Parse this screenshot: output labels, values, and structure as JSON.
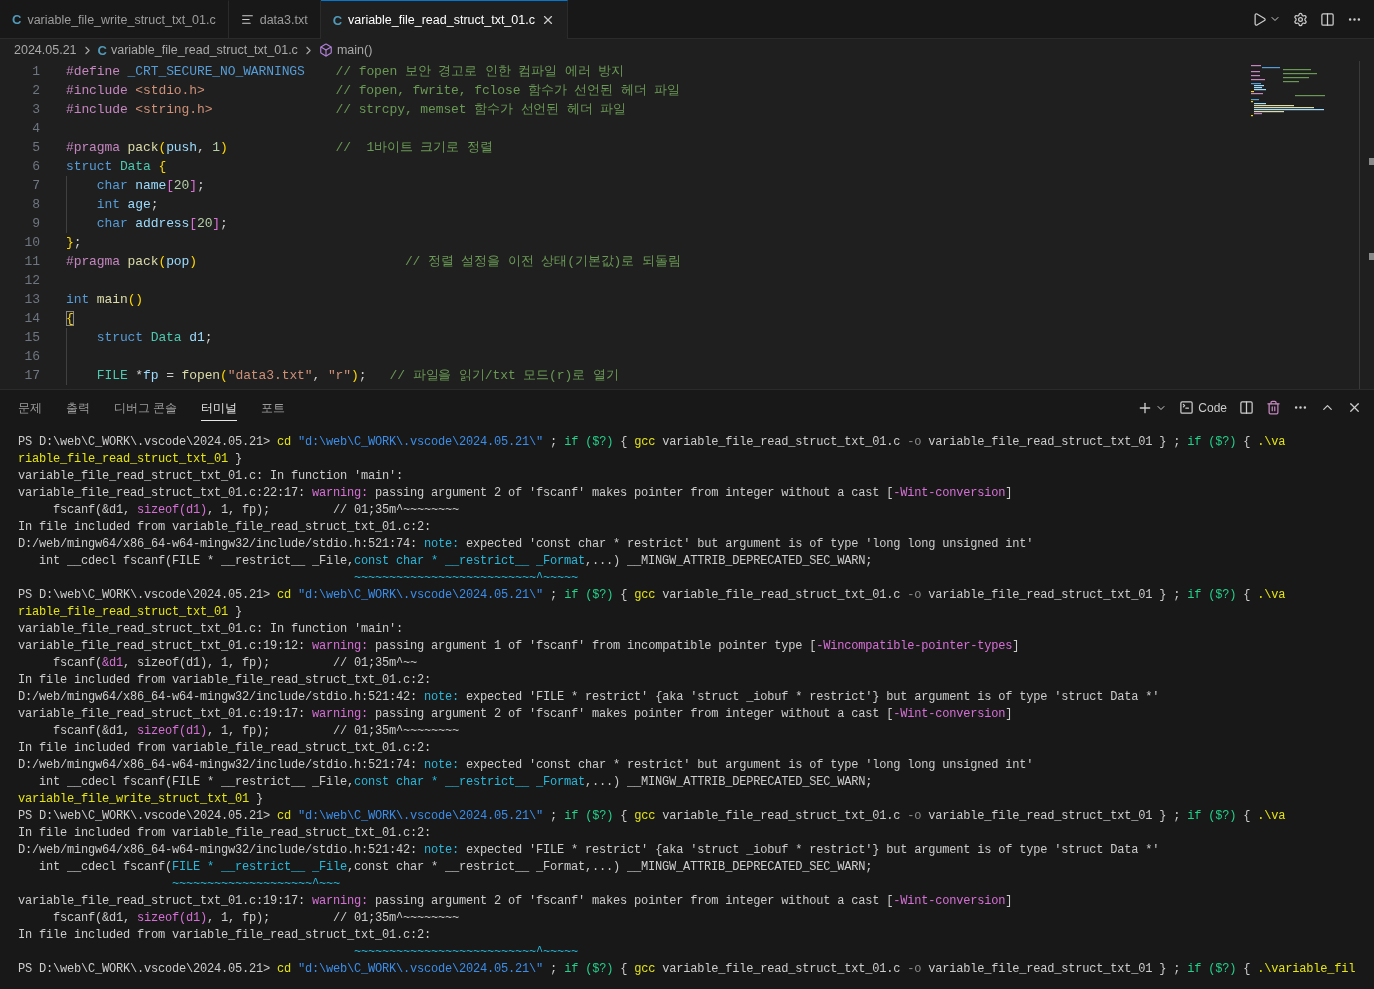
{
  "editor_tabs": [
    {
      "label": "variable_file_write_struct_txt_01.c",
      "kind": "c",
      "badge": "C",
      "selected": false
    },
    {
      "label": "data3.txt",
      "kind": "text",
      "selected": false
    },
    {
      "label": "variable_file_read_struct_txt_01.c",
      "kind": "c",
      "badge": "C",
      "selected": true
    }
  ],
  "breadcrumb": [
    {
      "label": "2024.05.21",
      "kind": "folder"
    },
    {
      "label": "variable_file_read_struct_txt_01.c",
      "kind": "c",
      "badge": "C"
    },
    {
      "label": "main()",
      "kind": "symbol"
    }
  ],
  "code_lines": [
    {
      "number": "1",
      "tokens": [
        {
          "text": "#define",
          "kind": "pp"
        },
        {
          "text": " _CRT_SECURE_NO_WARNINGS",
          "kind": "macro"
        },
        {
          "text": "    // fopen 보안 경고로 인한 컴파일 에러 방지",
          "kind": "cm"
        }
      ]
    },
    {
      "number": "2",
      "tokens": [
        {
          "text": "#include",
          "kind": "pp"
        },
        {
          "text": " <stdio.h>",
          "kind": "str"
        },
        {
          "text": "                 // fopen, fwrite, fclose 함수가 선언된 헤더 파일",
          "kind": "cm"
        }
      ]
    },
    {
      "number": "3",
      "tokens": [
        {
          "text": "#include",
          "kind": "pp"
        },
        {
          "text": " <string.h>",
          "kind": "str"
        },
        {
          "text": "                // strcpy, memset 함수가 선언된 헤더 파일",
          "kind": "cm"
        }
      ]
    },
    {
      "number": "4"
    },
    {
      "number": "5",
      "tokens": [
        {
          "text": "#pragma",
          "kind": "pp"
        },
        {
          "text": " pack",
          "kind": "fn"
        },
        {
          "text": "(",
          "kind": "paren"
        },
        {
          "text": "push",
          "kind": "var"
        },
        {
          "text": ",",
          "kind": "p"
        },
        {
          "text": " 1",
          "kind": "num"
        },
        {
          "text": ")",
          "kind": "paren"
        },
        {
          "text": "              //  1바이트 크기로 정렬",
          "kind": "cm"
        }
      ]
    },
    {
      "number": "6",
      "tokens": [
        {
          "text": "struct",
          "kind": "kw"
        },
        {
          "text": " Data",
          "kind": "type"
        },
        {
          "text": " {",
          "kind": "paren"
        }
      ]
    },
    {
      "number": "7",
      "guide": true,
      "tokens": [
        {
          "text": "    char",
          "kind": "kw"
        },
        {
          "text": " name",
          "kind": "var"
        },
        {
          "text": "[",
          "kind": "bracket"
        },
        {
          "text": "20",
          "kind": "num"
        },
        {
          "text": "]",
          "kind": "bracket"
        },
        {
          "text": ";",
          "kind": "p"
        }
      ]
    },
    {
      "number": "8",
      "guide": true,
      "tokens": [
        {
          "text": "    int",
          "kind": "kw"
        },
        {
          "text": " age",
          "kind": "var"
        },
        {
          "text": ";",
          "kind": "p"
        }
      ]
    },
    {
      "number": "9",
      "guide": true,
      "tokens": [
        {
          "text": "    char",
          "kind": "kw"
        },
        {
          "text": " address",
          "kind": "var"
        },
        {
          "text": "[",
          "kind": "bracket"
        },
        {
          "text": "20",
          "kind": "num"
        },
        {
          "text": "]",
          "kind": "bracket"
        },
        {
          "text": ";",
          "kind": "p"
        }
      ]
    },
    {
      "number": "10",
      "tokens": [
        {
          "text": "}",
          "kind": "paren"
        },
        {
          "text": ";",
          "kind": "p"
        }
      ]
    },
    {
      "number": "11",
      "tokens": [
        {
          "text": "#pragma",
          "kind": "pp"
        },
        {
          "text": " pack",
          "kind": "fn"
        },
        {
          "text": "(",
          "kind": "paren"
        },
        {
          "text": "pop",
          "kind": "var"
        },
        {
          "text": ")",
          "kind": "paren"
        },
        {
          "text": "                           // 정렬 설정을 이전 상태(기본값)로 되돌림",
          "kind": "cm"
        }
      ]
    },
    {
      "number": "12"
    },
    {
      "number": "13",
      "tokens": [
        {
          "text": "int",
          "kind": "kw"
        },
        {
          "text": " main",
          "kind": "fn"
        },
        {
          "text": "()",
          "kind": "paren"
        }
      ]
    },
    {
      "number": "14",
      "tokens": [
        {
          "text": "{",
          "kind": "match"
        }
      ]
    },
    {
      "number": "15",
      "guide": true,
      "tokens": [
        {
          "text": "    struct",
          "kind": "kw"
        },
        {
          "text": " Data",
          "kind": "type"
        },
        {
          "text": " d1",
          "kind": "var"
        },
        {
          "text": ";",
          "kind": "p"
        }
      ]
    },
    {
      "number": "16",
      "guide": true
    },
    {
      "number": "17",
      "guide": true,
      "tokens": [
        {
          "text": "    FILE",
          "kind": "type"
        },
        {
          "text": " *",
          "kind": "p"
        },
        {
          "text": "fp",
          "kind": "var"
        },
        {
          "text": " =",
          "kind": "p"
        },
        {
          "text": " fopen",
          "kind": "fn"
        },
        {
          "text": "(",
          "kind": "paren"
        },
        {
          "text": "\"data3.txt\"",
          "kind": "str"
        },
        {
          "text": ",",
          "kind": "p"
        },
        {
          "text": " \"r\"",
          "kind": "str"
        },
        {
          "text": ")",
          "kind": "paren"
        },
        {
          "text": ";",
          "kind": "p"
        },
        {
          "text": "   // 파일을 읽기/txt 모드(r)로 열기",
          "kind": "cm"
        }
      ]
    }
  ],
  "panel_tabs": [
    {
      "label": "문제",
      "selected": false
    },
    {
      "label": "출력",
      "selected": false
    },
    {
      "label": "디버그 콘솔",
      "selected": false
    },
    {
      "label": "터미널",
      "selected": true
    },
    {
      "label": "포트",
      "selected": false
    }
  ],
  "terminal_profile": "Code",
  "terminal_lines": [
    [
      {
        "text": "PS D:\\web\\C_WORK\\.vscode\\2024.05.21>",
        "kind": "plain"
      },
      {
        "text": " cd",
        "kind": "cmd"
      },
      {
        "text": " \"d:\\web\\C_WORK\\.vscode\\2024.05.21\\\"",
        "kind": "str"
      },
      {
        "text": " ;",
        "kind": "plain"
      },
      {
        "text": " if ($?)",
        "kind": "kw"
      },
      {
        "text": " {",
        "kind": "plain"
      },
      {
        "text": " gcc",
        "kind": "cmd"
      },
      {
        "text": " variable_file_read_struct_txt_01.c",
        "kind": "plain"
      },
      {
        "text": " -o",
        "kind": "dim"
      },
      {
        "text": " variable_file_read_struct_txt_01 } ;",
        "kind": "plain"
      },
      {
        "text": " if ($?)",
        "kind": "kw"
      },
      {
        "text": " {",
        "kind": "plain"
      },
      {
        "text": " .\\va",
        "kind": "cmd"
      }
    ],
    [
      {
        "text": "riable_file_read_struct_txt_01",
        "kind": "cmd"
      },
      {
        "text": " }",
        "kind": "plain"
      }
    ],
    [
      {
        "text": "variable_file_read_struct_txt_01.c: In function 'main':",
        "kind": "plain"
      }
    ],
    [
      {
        "text": "variable_file_read_struct_txt_01.c:22:17:",
        "kind": "plain"
      },
      {
        "text": " warning:",
        "kind": "warn"
      },
      {
        "text": " passing argument 2 of 'fscanf' makes pointer from integer without a cast [",
        "kind": "plain"
      },
      {
        "text": "-Wint-conversion",
        "kind": "warn"
      },
      {
        "text": "]",
        "kind": "plain"
      }
    ],
    [
      {
        "text": "     fscanf(&d1,",
        "kind": "plain"
      },
      {
        "text": " sizeof(d1)",
        "kind": "warn"
      },
      {
        "text": ", 1, fp);         // 01;35m^~~~~~~~~",
        "kind": "plain"
      }
    ],
    [
      {
        "text": "In file included from variable_file_read_struct_txt_01.c:2:",
        "kind": "plain"
      }
    ],
    [
      {
        "text": "D:/web/mingw64/x86_64-w64-mingw32/include/stdio.h:521:74:",
        "kind": "plain"
      },
      {
        "text": " note:",
        "kind": "note"
      },
      {
        "text": " expected 'const char * restrict' but argument is of type 'long long unsigned int'",
        "kind": "plain"
      }
    ],
    [
      {
        "text": "   int __cdecl fscanf(FILE * __restrict__ _File,",
        "kind": "plain"
      },
      {
        "text": "const char * __restrict__ _Format",
        "kind": "note"
      },
      {
        "text": ",...) __MINGW_ATTRIB_DEPRECATED_SEC_WARN;",
        "kind": "plain"
      }
    ],
    [
      {
        "text": "                                                ~~~~~~~~~~~~~~~~~~~~~~~~~~^~~~~~",
        "kind": "note"
      }
    ],
    [
      {
        "text": "PS D:\\web\\C_WORK\\.vscode\\2024.05.21>",
        "kind": "plain"
      },
      {
        "text": " cd",
        "kind": "cmd"
      },
      {
        "text": " \"d:\\web\\C_WORK\\.vscode\\2024.05.21\\\"",
        "kind": "str"
      },
      {
        "text": " ;",
        "kind": "plain"
      },
      {
        "text": " if ($?)",
        "kind": "kw"
      },
      {
        "text": " {",
        "kind": "plain"
      },
      {
        "text": " gcc",
        "kind": "cmd"
      },
      {
        "text": " variable_file_read_struct_txt_01.c",
        "kind": "plain"
      },
      {
        "text": " -o",
        "kind": "dim"
      },
      {
        "text": " variable_file_read_struct_txt_01 } ;",
        "kind": "plain"
      },
      {
        "text": " if ($?)",
        "kind": "kw"
      },
      {
        "text": " {",
        "kind": "plain"
      },
      {
        "text": " .\\va",
        "kind": "cmd"
      }
    ],
    [
      {
        "text": "riable_file_read_struct_txt_01",
        "kind": "cmd"
      },
      {
        "text": " }",
        "kind": "plain"
      }
    ],
    [
      {
        "text": "variable_file_read_struct_txt_01.c: In function 'main':",
        "kind": "plain"
      }
    ],
    [
      {
        "text": "variable_file_read_struct_txt_01.c:19:12:",
        "kind": "plain"
      },
      {
        "text": " warning:",
        "kind": "warn"
      },
      {
        "text": " passing argument 1 of 'fscanf' from incompatible pointer type [",
        "kind": "plain"
      },
      {
        "text": "-Wincompatible-pointer-types",
        "kind": "warn"
      },
      {
        "text": "]",
        "kind": "plain"
      }
    ],
    [
      {
        "text": "     fscanf(",
        "kind": "plain"
      },
      {
        "text": "&d1",
        "kind": "warn"
      },
      {
        "text": ", sizeof(d1), 1, fp);         // 01;35m^~~",
        "kind": "plain"
      }
    ],
    [
      {
        "text": "In file included from variable_file_read_struct_txt_01.c:2:",
        "kind": "plain"
      }
    ],
    [
      {
        "text": "D:/web/mingw64/x86_64-w64-mingw32/include/stdio.h:521:42:",
        "kind": "plain"
      },
      {
        "text": " note:",
        "kind": "note"
      },
      {
        "text": " expected 'FILE * restrict' {aka 'struct _iobuf * restrict'} but argument is of type 'struct Data *'",
        "kind": "plain"
      }
    ],
    [
      {
        "text": "variable_file_read_struct_txt_01.c:19:17:",
        "kind": "plain"
      },
      {
        "text": " warning:",
        "kind": "warn"
      },
      {
        "text": " passing argument 2 of 'fscanf' makes pointer from integer without a cast [",
        "kind": "plain"
      },
      {
        "text": "-Wint-conversion",
        "kind": "warn"
      },
      {
        "text": "]",
        "kind": "plain"
      }
    ],
    [
      {
        "text": "     fscanf(&d1,",
        "kind": "plain"
      },
      {
        "text": " sizeof(d1)",
        "kind": "warn"
      },
      {
        "text": ", 1, fp);         // 01;35m^~~~~~~~~",
        "kind": "plain"
      }
    ],
    [
      {
        "text": "In file included from variable_file_read_struct_txt_01.c:2:",
        "kind": "plain"
      }
    ],
    [
      {
        "text": "D:/web/mingw64/x86_64-w64-mingw32/include/stdio.h:521:74:",
        "kind": "plain"
      },
      {
        "text": " note:",
        "kind": "note"
      },
      {
        "text": " expected 'const char * restrict' but argument is of type 'long long unsigned int'",
        "kind": "plain"
      }
    ],
    [
      {
        "text": "   int __cdecl fscanf(FILE * __restrict__ _File,",
        "kind": "plain"
      },
      {
        "text": "const char * __restrict__ _Format",
        "kind": "note"
      },
      {
        "text": ",...) __MINGW_ATTRIB_DEPRECATED_SEC_WARN;",
        "kind": "plain"
      }
    ],
    [
      {
        "text": "variable_file_write_struct_txt_01",
        "kind": "cmd"
      },
      {
        "text": " }",
        "kind": "plain"
      }
    ],
    [
      {
        "text": "PS D:\\web\\C_WORK\\.vscode\\2024.05.21>",
        "kind": "plain"
      },
      {
        "text": " cd",
        "kind": "cmd"
      },
      {
        "text": " \"d:\\web\\C_WORK\\.vscode\\2024.05.21\\\"",
        "kind": "str"
      },
      {
        "text": " ;",
        "kind": "plain"
      },
      {
        "text": " if ($?)",
        "kind": "kw"
      },
      {
        "text": " {",
        "kind": "plain"
      },
      {
        "text": " gcc",
        "kind": "cmd"
      },
      {
        "text": " variable_file_read_struct_txt_01.c",
        "kind": "plain"
      },
      {
        "text": " -o",
        "kind": "dim"
      },
      {
        "text": " variable_file_read_struct_txt_01 } ;",
        "kind": "plain"
      },
      {
        "text": " if ($?)",
        "kind": "kw"
      },
      {
        "text": " {",
        "kind": "plain"
      },
      {
        "text": " .\\va",
        "kind": "cmd"
      }
    ],
    [
      {
        "text": "In file included from variable_file_read_struct_txt_01.c:2:",
        "kind": "plain"
      }
    ],
    [
      {
        "text": "D:/web/mingw64/x86_64-w64-mingw32/include/stdio.h:521:42:",
        "kind": "plain"
      },
      {
        "text": " note:",
        "kind": "note"
      },
      {
        "text": " expected 'FILE * restrict' {aka 'struct _iobuf * restrict'} but argument is of type 'struct Data *'",
        "kind": "plain"
      }
    ],
    [
      {
        "text": "   int __cdecl fscanf(",
        "kind": "plain"
      },
      {
        "text": "FILE * __restrict__ _File",
        "kind": "note"
      },
      {
        "text": ",const char * __restrict__ _Format,...) __MINGW_ATTRIB_DEPRECATED_SEC_WARN;",
        "kind": "plain"
      }
    ],
    [
      {
        "text": "                      ~~~~~~~~~~~~~~~~~~~~^~~~",
        "kind": "note"
      }
    ],
    [
      {
        "text": "variable_file_read_struct_txt_01.c:19:17:",
        "kind": "plain"
      },
      {
        "text": " warning:",
        "kind": "warn"
      },
      {
        "text": " passing argument 2 of 'fscanf' makes pointer from integer without a cast [",
        "kind": "plain"
      },
      {
        "text": "-Wint-conversion",
        "kind": "warn"
      },
      {
        "text": "]",
        "kind": "plain"
      }
    ],
    [
      {
        "text": "     fscanf(&d1,",
        "kind": "plain"
      },
      {
        "text": " sizeof(d1)",
        "kind": "warn"
      },
      {
        "text": ", 1, fp);         // 01;35m^~~~~~~~~",
        "kind": "plain"
      }
    ],
    [
      {
        "text": "In file included from variable_file_read_struct_txt_01.c:2:",
        "kind": "plain"
      }
    ],
    [
      {
        "text": "                                                ~~~~~~~~~~~~~~~~~~~~~~~~~~^~~~~~",
        "kind": "note"
      }
    ],
    [
      {
        "text": "PS D:\\web\\C_WORK\\.vscode\\2024.05.21>",
        "kind": "plain"
      },
      {
        "text": " cd",
        "kind": "cmd"
      },
      {
        "text": " \"d:\\web\\C_WORK\\.vscode\\2024.05.21\\\"",
        "kind": "str"
      },
      {
        "text": " ;",
        "kind": "plain"
      },
      {
        "text": " if ($?)",
        "kind": "kw"
      },
      {
        "text": " {",
        "kind": "plain"
      },
      {
        "text": " gcc",
        "kind": "cmd"
      },
      {
        "text": " variable_file_read_struct_txt_01.c",
        "kind": "plain"
      },
      {
        "text": " -o",
        "kind": "dim"
      },
      {
        "text": " variable_file_read_struct_txt_01 } ;",
        "kind": "plain"
      },
      {
        "text": " if ($?)",
        "kind": "kw"
      },
      {
        "text": " {",
        "kind": "plain"
      },
      {
        "text": " .\\variable_fil",
        "kind": "cmd"
      }
    ]
  ]
}
